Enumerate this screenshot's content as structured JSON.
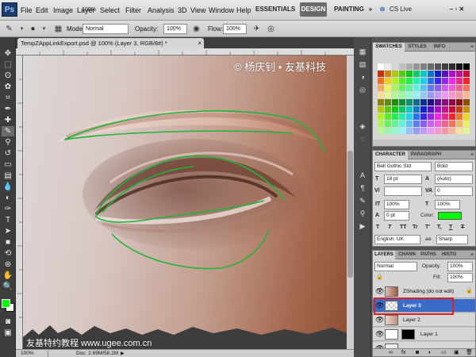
{
  "menubar": {
    "logo": "Ps",
    "items": [
      "File",
      "Edit",
      "Image",
      "Layer",
      "Select",
      "Filter",
      "Analysis",
      "3D",
      "View",
      "Window",
      "Help"
    ],
    "zoom": "100%",
    "workspaces": {
      "essentials": "ESSENTIALS",
      "design": "DESIGN",
      "painting": "PAINTING"
    },
    "more": "»",
    "cs_live": "CS Live",
    "window_controls": "–  ▫  ✕"
  },
  "options": {
    "mode_label": "Mode:",
    "mode_value": "Normal",
    "opacity_label": "Opacity:",
    "opacity_value": "100%",
    "flow_label": "Flow:",
    "flow_value": "100%"
  },
  "document": {
    "tab_title": "TempZAppLinkExport.psd @ 100% (Layer 3, RGB/8#) *",
    "close": "×",
    "zoom": "100%",
    "doc_info": "Doc: 2.69M/58.2M"
  },
  "watermarks": {
    "top": "© 杨庆钊 • 友基科技",
    "bottom": "友基特约教程  www.ugee.com.cn"
  },
  "tool_colors": {
    "foreground": "#00ff00",
    "background": "#ffffff"
  },
  "swatches_panel": {
    "tabs": [
      "SWATCHES",
      "STYLES",
      "INFO"
    ]
  },
  "character_panel": {
    "tabs": [
      "CHARACTER",
      "PARAGRAPH"
    ],
    "font_family": "Bell Gothic Std",
    "font_style": "Bold",
    "font_size": "18 pt",
    "leading": "(Auto)",
    "kerning": "",
    "tracking": "0",
    "vertical_scale": "100%",
    "horizontal_scale": "100%",
    "baseline_shift": "0 pt",
    "color_label": "Color:",
    "color_value": "#00ff00",
    "style_buttons": [
      "T",
      "T",
      "TT",
      "Tr",
      "T'",
      "T,",
      "T",
      "T"
    ],
    "language": "English: UK",
    "aa_label": "aa",
    "antialias": "Sharp"
  },
  "layers_panel": {
    "tabs": [
      "LAYERS",
      "CHANN",
      "PATHS",
      "HISTO"
    ],
    "blend_mode": "Normal",
    "opacity_label": "Opacity:",
    "opacity_value": "100%",
    "fill_label": "Fill:",
    "fill_value": "100%",
    "layers": [
      {
        "name": "ZShading (do not edit)",
        "selected": false
      },
      {
        "name": "Layer 3",
        "selected": true
      },
      {
        "name": "Layer 2",
        "selected": false
      },
      {
        "name": "Layer 1",
        "selected": false
      },
      {
        "name": "",
        "selected": false
      }
    ]
  }
}
